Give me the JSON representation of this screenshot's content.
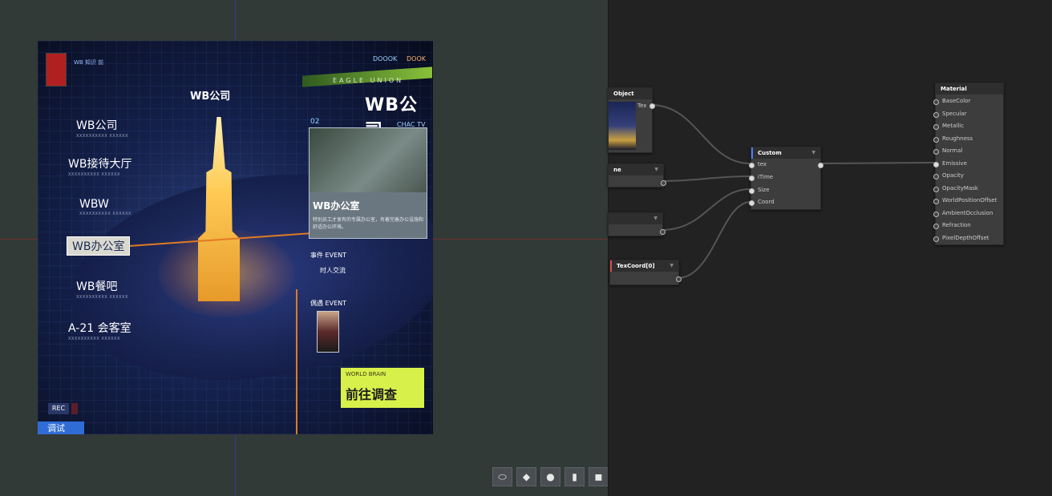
{
  "viewport": {
    "preview": {
      "top_tag": "WB 知识 前",
      "corner_logo": "corner-logo",
      "eng_banner": "EAGLE UNION",
      "big_title": "WB公司",
      "header_tag": "CHAC TV",
      "top_title": "WB公司",
      "menu_items": [
        {
          "label": "WB公司",
          "sub": "XXXXXXXXXX XXXXXX"
        },
        {
          "label": "WB接待大厅",
          "sub": "XXXXXXXXXX XXXXXX"
        },
        {
          "label": "WBW",
          "sub": "XXXXXXXXXX XXXXXX"
        },
        {
          "label": "WB办公室",
          "sub": "XXXXXXXXXX XXXXXX"
        },
        {
          "label": "WB餐吧",
          "sub": "XXXXXXXXXX XXXXXX"
        },
        {
          "label": "A-21 会客室",
          "sub": "XXXXXXXXXX XXXXXX"
        }
      ],
      "panel": {
        "number": "02",
        "title": "WB办公室",
        "desc": "特别员工才享有的专属办公室，有着完善办公设施和舒适办公环境。"
      },
      "events": [
        {
          "label": "事件 EVENT",
          "sub": "时人交流"
        },
        {
          "label": "偶遇 EVENT",
          "sub": ""
        }
      ],
      "cta": {
        "small": "WORLD BRAIN",
        "label": "前往调查"
      },
      "rec": "REC",
      "debug": "调试",
      "brand_left": "DOOOK",
      "brand_right": "DOOK"
    },
    "view_buttons": [
      {
        "name": "custom-view-icon",
        "glyph": "⬭"
      },
      {
        "name": "plane-view-icon",
        "glyph": "◆"
      },
      {
        "name": "sphere-view-icon",
        "glyph": "●"
      },
      {
        "name": "cylinder-view-icon",
        "glyph": "▮"
      },
      {
        "name": "cube-view-icon",
        "glyph": "◼"
      }
    ]
  },
  "graph": {
    "texture_node": {
      "title": "Object",
      "pin": "Tex"
    },
    "time_node": {
      "title": "ne"
    },
    "size_node": {
      "title": ""
    },
    "texcoord_node": {
      "title": "TexCoord[0]"
    },
    "custom_node": {
      "title": "Custom",
      "inputs": [
        "tex",
        "iTime",
        "Size",
        "Coord"
      ]
    },
    "material_node": {
      "title": "Material",
      "inputs": [
        "BaseColor",
        "Specular",
        "Metallic",
        "Roughness",
        "Normal",
        "Emissive",
        "Opacity",
        "OpacityMask",
        "WorldPositionOffset",
        "AmbientOcclusion",
        "Refraction",
        "PixelDepthOffset"
      ],
      "connected": "Emissive"
    },
    "colors": {
      "custom_accent": "#4a7dff",
      "texcoord_accent": "#e04a4a",
      "wire": "#555555"
    }
  }
}
